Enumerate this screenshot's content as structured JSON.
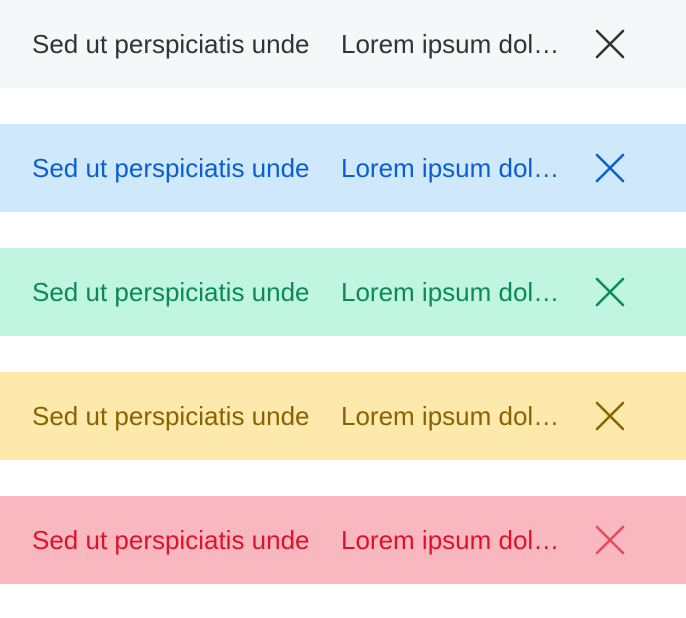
{
  "alerts": [
    {
      "variant": "default",
      "title": "Sed ut perspiciatis unde",
      "message": "Lorem ipsum dolor sit amet, consectetur adipiscing elit",
      "close_icon": "close-icon",
      "colors": {
        "background": "#f6f7f9",
        "text": "#333333",
        "icon": "#333333"
      }
    },
    {
      "variant": "info",
      "title": "Sed ut perspiciatis unde",
      "message": "Lorem ipsum dolor sit amet, consectetur adipiscing elit",
      "close_icon": "close-icon",
      "colors": {
        "background": "#d0e8fb",
        "text": "#0a5fd0",
        "icon": "#0a5fd0"
      }
    },
    {
      "variant": "success",
      "title": "Sed ut perspiciatis unde",
      "message": "Lorem ipsum dolor sit amet, consectetur adipiscing elit",
      "close_icon": "close-icon",
      "colors": {
        "background": "#c0f5e1",
        "text": "#0b8a57",
        "icon": "#0b8a57"
      }
    },
    {
      "variant": "warning",
      "title": "Sed ut perspiciatis unde",
      "message": "Lorem ipsum dolor sit amet, consectetur adipiscing elit",
      "close_icon": "close-icon",
      "colors": {
        "background": "#fde9ac",
        "text": "#8a6300",
        "icon": "#8a6300"
      }
    },
    {
      "variant": "danger",
      "title": "Sed ut perspiciatis unde",
      "message": "Lorem ipsum dolor sit amet, consectetur adipiscing elit",
      "close_icon": "close-icon",
      "colors": {
        "background": "#f9b7c0",
        "text": "#e0112b",
        "icon": "#e94a5c"
      }
    }
  ]
}
